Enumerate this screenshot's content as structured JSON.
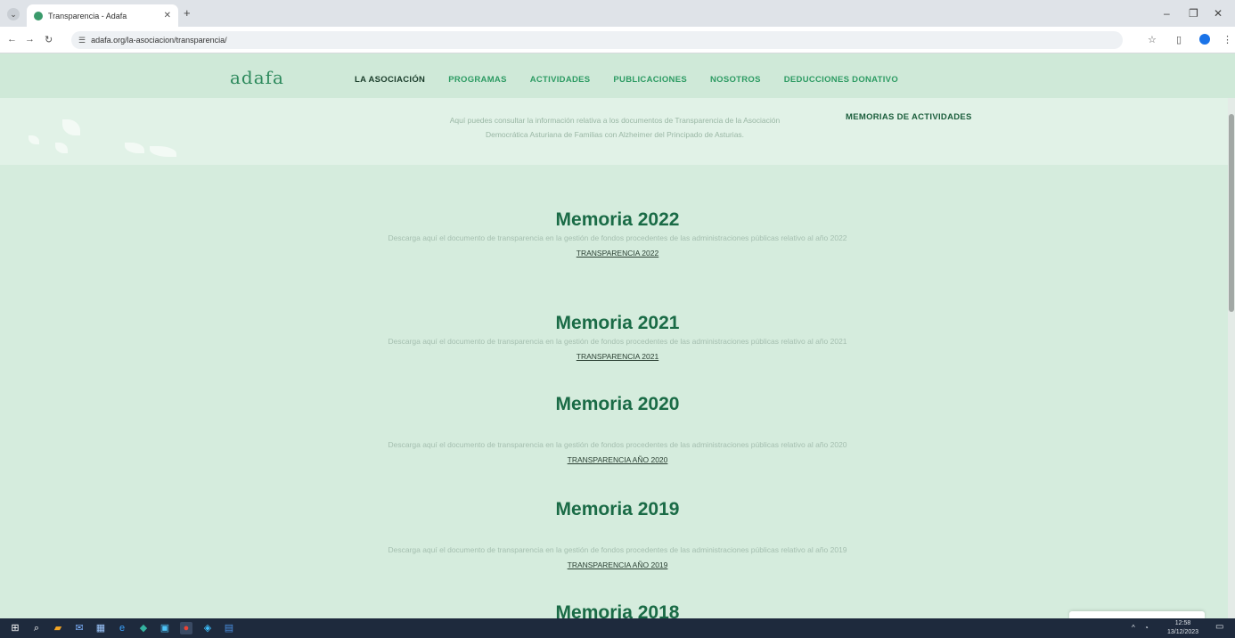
{
  "browser": {
    "tab_title": "Transparencia - Adafa",
    "url": "adafa.org/la-asociacion/transparencia/"
  },
  "site": {
    "logo": "adafa",
    "nav": [
      {
        "label": "LA ASOCIACIÓN"
      },
      {
        "label": "PROGRAMAS"
      },
      {
        "label": "ACTIVIDADES"
      },
      {
        "label": "PUBLICACIONES"
      },
      {
        "label": "NOSOTROS"
      },
      {
        "label": "DEDUCCIONES DONATIVO"
      }
    ],
    "submenu_item": "MEMORIAS DE ACTIVIDADES",
    "intro_line1": "Aquí puedes consultar la información relativa a los documentos de Transparencia de la Asociación",
    "intro_line2": "Democrática Asturiana de Familias con Alzheimer del Principado de Asturias."
  },
  "memorias": [
    {
      "title": "Memoria 2022",
      "desc": "Descarga aquí el documento de transparencia en la gestión de fondos procedentes de las administraciones públicas relativo al año 2022",
      "link": "TRANSPARENCIA 2022"
    },
    {
      "title": "Memoria 2021",
      "desc": "Descarga aquí el documento de transparencia en la gestión de fondos procedentes de las administraciones públicas relativo al año 2021",
      "link": "TRANSPARENCIA 2021"
    },
    {
      "title": "Memoria 2020",
      "desc": "Descarga aquí el documento de transparencia en la gestión de fondos procedentes de las administraciones públicas relativo al año 2020",
      "link": "TRANSPARENCIA AÑO 2020"
    },
    {
      "title": "Memoria 2019",
      "desc": "Descarga aquí el documento de transparencia en la gestión de fondos procedentes de las administraciones públicas relativo al año 2019",
      "link": "TRANSPARENCIA AÑO 2019"
    },
    {
      "title": "Memoria 2018"
    }
  ],
  "taskbar": {
    "time": "12:58",
    "date": "13/12/2023"
  },
  "colors": {
    "page_bg": "#d5ecdd",
    "heading": "#1a6b46",
    "nav_link": "#2d9b63"
  }
}
